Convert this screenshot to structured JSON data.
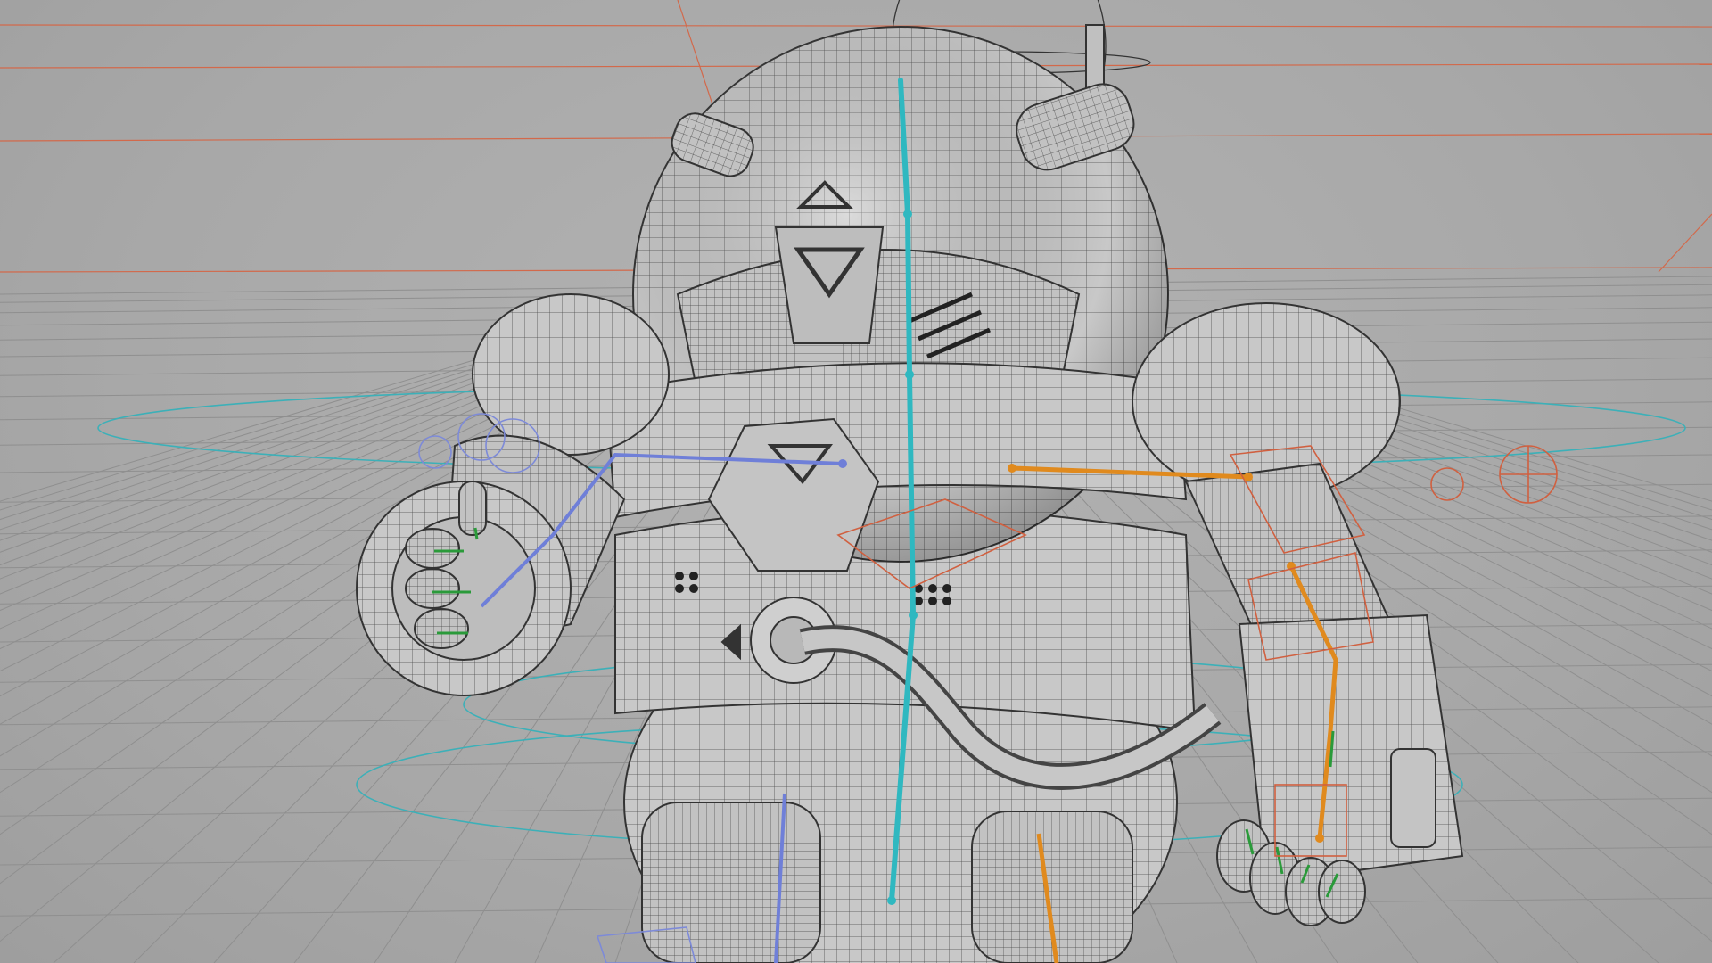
{
  "viewport": {
    "background": "#a9a9a9",
    "floor_grid_color": "#8f8f8f",
    "horizon_line_color": "#d2694b",
    "wire_color": "#3a3a3a",
    "shade_color": "#c9c9c9"
  },
  "rig": {
    "spine_bone_color": "#2fb8c0",
    "right_arm_bone_color": "#e08a1e",
    "left_arm_bone_color": "#6f7fd8",
    "finger_bone_color": "#2a9a3a",
    "ik_control_color": "#d06040",
    "fk_control_color": "#3cb0b8",
    "left_control_color": "#7d8ad8"
  },
  "icons": {
    "center_target": "ik-target-circle-icon",
    "side_target": "ik-locator-circle-icon"
  }
}
